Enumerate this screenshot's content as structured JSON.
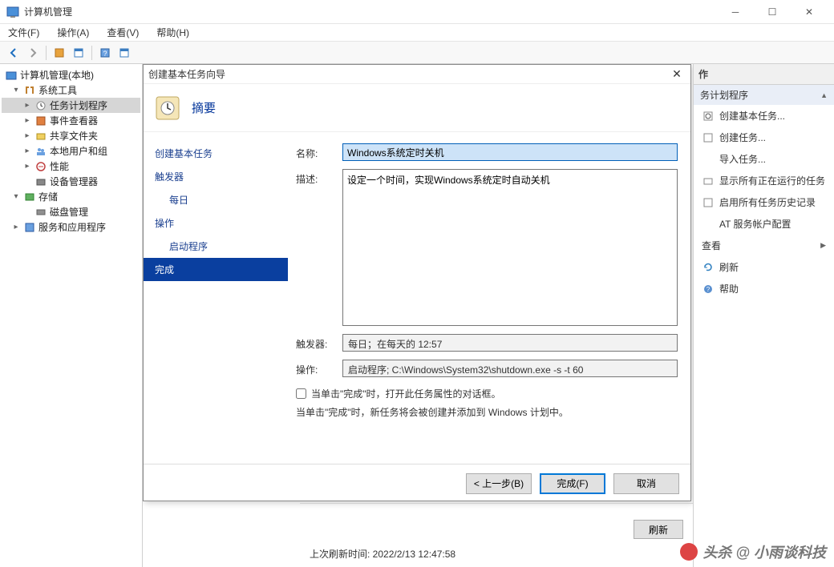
{
  "titlebar": {
    "title": "计算机管理"
  },
  "menubar": {
    "file": "文件(F)",
    "action": "操作(A)",
    "view": "查看(V)",
    "help": "帮助(H)"
  },
  "tree": {
    "root": "计算机管理(本地)",
    "systools": "系统工具",
    "taskschd": "任务计划程序",
    "eventvwr": "事件查看器",
    "shares": "共享文件夹",
    "localusers": "本地用户和组",
    "perf": "性能",
    "devmgr": "设备管理器",
    "storage": "存储",
    "diskmgr": "磁盘管理",
    "services": "服务和应用程序"
  },
  "dialog": {
    "title": "创建基本任务向导",
    "subtitle": "摘要",
    "steps": {
      "create": "创建基本任务",
      "trigger": "触发器",
      "daily": "每日",
      "action": "操作",
      "startprog": "启动程序",
      "finish": "完成"
    },
    "labels": {
      "name": "名称:",
      "desc": "描述:",
      "trigger": "触发器:",
      "action": "操作:"
    },
    "values": {
      "name": "Windows系统定时关机",
      "desc": "设定一个时间，实现Windows系统定时自动关机",
      "trigger": "每日；在每天的 12:57",
      "action": "启动程序; C:\\Windows\\System32\\shutdown.exe -s -t 60"
    },
    "checkbox": "当单击\"完成\"时，打开此任务属性的对话框。",
    "hint": "当单击\"完成\"时，新任务将会被创建并添加到 Windows 计划中。",
    "buttons": {
      "back": "< 上一步(B)",
      "finish": "完成(F)",
      "cancel": "取消"
    }
  },
  "actions": {
    "header": "作",
    "section": "务计划程序",
    "items": {
      "createbasic": "创建基本任务...",
      "createtask": "创建任务...",
      "import": "导入任务...",
      "showrunning": "显示所有正在运行的任务",
      "enablehistory": "启用所有任务历史记录",
      "atconfig": "AT 服务帐户配置",
      "view": "查看",
      "refresh": "刷新",
      "help": "帮助"
    }
  },
  "bottom": {
    "refresh": "刷新",
    "lastrefresh": "上次刷新时间: 2022/2/13 12:47:58"
  },
  "watermark": "头杀 @ 小雨谈科技"
}
